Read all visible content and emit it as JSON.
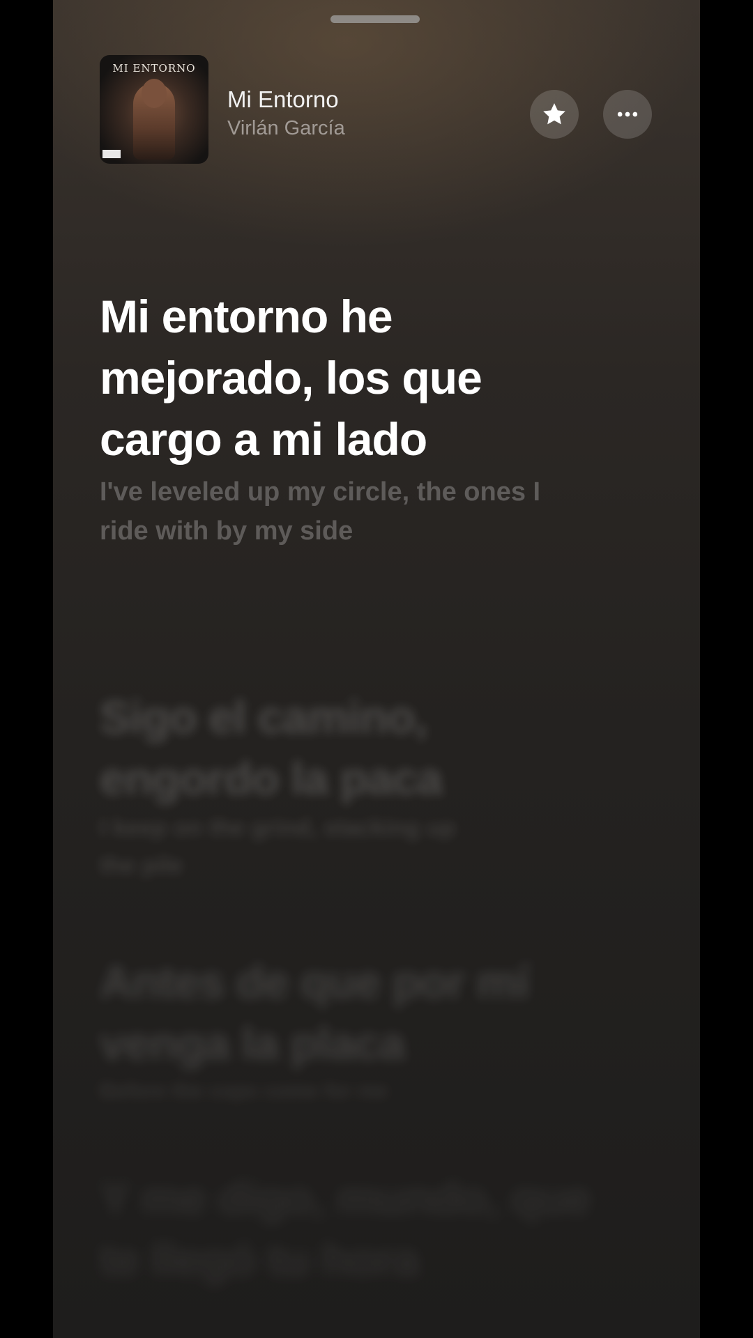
{
  "header": {
    "artwork_title": "MI ENTORNO",
    "title": "Mi Entorno",
    "artist": "Virlán García"
  },
  "actions": {
    "favorite_icon": "star-icon",
    "more_icon": "ellipsis-icon"
  },
  "lyrics": [
    {
      "text": "Mi entorno he\nmejorado, los que\ncargo a mi lado",
      "translation": "I've leveled up my circle, the ones I\nride with by my side",
      "state": "current"
    },
    {
      "text": "Sigo el camino,\nengordo la paca",
      "translation": "I keep on the grind, stacking up\nthe pile",
      "state": "upcoming"
    },
    {
      "text": "Antes de que por mí\nvenga la placa",
      "translation": "Before the cops come for me",
      "state": "upcoming"
    },
    {
      "text": "Y me digo, mundo, que\nte llegó tu hora",
      "translation": "",
      "state": "upcoming"
    }
  ]
}
